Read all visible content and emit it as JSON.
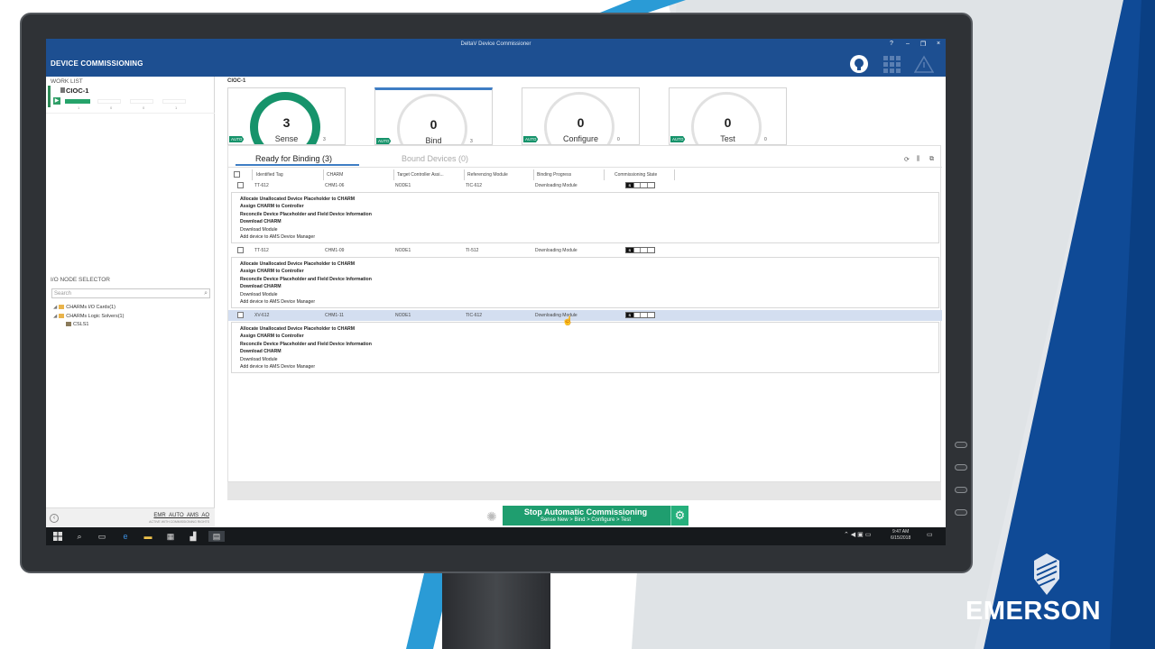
{
  "window": {
    "title": "DeltaV Device Commissioner",
    "app_title": "DEVICE COMMISSIONING",
    "controls": [
      "?",
      "–",
      "❐",
      "×"
    ]
  },
  "brand": {
    "name": "EMERSON",
    "color": "#1d4f91"
  },
  "colors": {
    "header": "#1d4f91",
    "accent_green": "#16936b",
    "tab_blue": "#3e7dc4"
  },
  "work_list": {
    "label": "WORK LIST",
    "item": "CIOC-1",
    "counters": [
      "1",
      "0",
      "0",
      "1"
    ]
  },
  "io_node_selector": {
    "label": "I/O NODE SELECTOR",
    "search_placeholder": "Search",
    "tree": [
      {
        "label": "CHARMs I/O Cards(1)",
        "level": 0
      },
      {
        "label": "CHARMs Logic Solvers(1)",
        "level": 0
      },
      {
        "label": "CSLS1",
        "level": 1
      }
    ]
  },
  "footer_user": {
    "name": "EMR_AUTO_AMS_AO",
    "sub": "ACTIVE WITH COMMISSIONING RIGHTS"
  },
  "breadcrumb": "CIOC-1",
  "stages": [
    {
      "value": "3",
      "name": "Sense",
      "badge": "AUTO",
      "count": "3"
    },
    {
      "value": "0",
      "name": "Bind",
      "badge": "AUTO",
      "count": "3"
    },
    {
      "value": "0",
      "name": "Configure",
      "badge": "AUTO",
      "count": "0"
    },
    {
      "value": "0",
      "name": "Test",
      "badge": "AUTO",
      "count": "0"
    }
  ],
  "tabs": {
    "ready": "Ready for Binding (3)",
    "bound": "Bound Devices (0)"
  },
  "columns": [
    "Identified Tag",
    "CHARM",
    "Target Controller Assi...",
    "Referencing Module",
    "Binding Progress",
    "Commissioning State"
  ],
  "rows": [
    {
      "tag": "TT-612",
      "charm": "CHM1-06",
      "controller": "NODE1",
      "module": "TIC-612",
      "progress": "Downloading Module",
      "state": "S"
    },
    {
      "tag": "TT-512",
      "charm": "CHM1-09",
      "controller": "NODE1",
      "module": "TI-512",
      "progress": "Downloading Module",
      "state": "S"
    },
    {
      "tag": "XV-612",
      "charm": "CHM1-11",
      "controller": "NODE1",
      "module": "TIC-612",
      "progress": "Downloading Module",
      "state": "S"
    }
  ],
  "steps": [
    "Allocate Unallocated Device Placeholder to CHARM",
    "Assign CHARM to Controller",
    "Reconcile Device Placeholder and Field Device Information",
    "Download CHARM",
    "Download Module",
    "Add device to AMS Device Manager"
  ],
  "action": {
    "title": "Stop Automatic Commissioning",
    "sub": "Sense New >   Bind >   Configure >   Test"
  },
  "clock": {
    "time": "9:47 AM",
    "date": "6/15/2018"
  }
}
